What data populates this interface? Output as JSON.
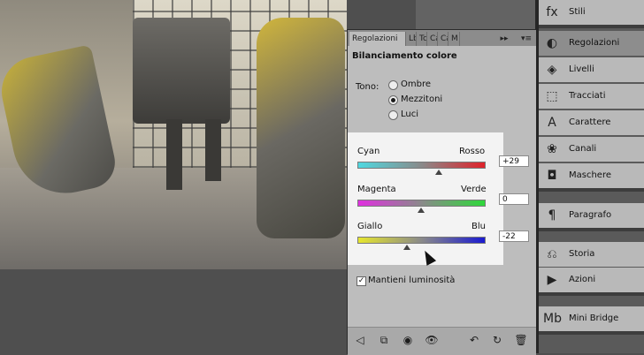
{
  "panel": {
    "tabs": [
      "Regolazioni",
      "Lb",
      "Tc",
      "Ca",
      "Ca",
      "M"
    ],
    "collapse_glyph": "▸▸",
    "menu_glyph": "▾≡",
    "title": "Bilanciamento colore",
    "tono_label": "Tono:",
    "tone_options": [
      {
        "label": "Ombre",
        "selected": false
      },
      {
        "label": "Mezzitoni",
        "selected": true
      },
      {
        "label": "Luci",
        "selected": false
      }
    ],
    "sliders": [
      {
        "left": "Cyan",
        "right": "Rosso",
        "value": "+29",
        "numeric": 29,
        "gradient": [
          "#4fd8e0",
          "#e0222a"
        ]
      },
      {
        "left": "Magenta",
        "right": "Verde",
        "value": "0",
        "numeric": 0,
        "gradient": [
          "#e02fe0",
          "#2ed83a"
        ]
      },
      {
        "left": "Giallo",
        "right": "Blu",
        "value": "-22",
        "numeric": -22,
        "gradient": [
          "#e6e62e",
          "#1a1ad0"
        ]
      }
    ],
    "preserve_luminosity": {
      "label": "Mantieni luminosità",
      "checked": true,
      "check_glyph": "✓"
    },
    "footer_icons": [
      {
        "name": "back-icon",
        "glyph": "◁"
      },
      {
        "name": "clip-layer-icon",
        "glyph": "⧉"
      },
      {
        "name": "mask-icon",
        "glyph": "◉"
      },
      {
        "name": "visibility-icon",
        "glyph": "👁"
      },
      {
        "name": "previous-state-icon",
        "glyph": "↶"
      },
      {
        "name": "reset-icon",
        "glyph": "↻"
      },
      {
        "name": "trash-icon",
        "glyph": "🗑"
      }
    ]
  },
  "dock": {
    "items": [
      {
        "label": "Stili",
        "icon": "fx-icon",
        "glyph": "fx",
        "active": false
      },
      {
        "label": "Regolazioni",
        "icon": "adjustments-icon",
        "glyph": "◐",
        "active": true
      },
      {
        "label": "Livelli",
        "icon": "layers-icon",
        "glyph": "◈",
        "active": false
      },
      {
        "label": "Tracciati",
        "icon": "paths-icon",
        "glyph": "⬚",
        "active": false
      },
      {
        "label": "Carattere",
        "icon": "character-icon",
        "glyph": "A",
        "active": false
      },
      {
        "label": "Canali",
        "icon": "channels-icon",
        "glyph": "❀",
        "active": false
      },
      {
        "label": "Maschere",
        "icon": "masks-icon",
        "glyph": "◘",
        "active": false
      },
      {
        "label": "Paragrafo",
        "icon": "paragraph-icon",
        "glyph": "¶",
        "active": false
      },
      {
        "label": "Storia",
        "icon": "history-icon",
        "glyph": "⎌",
        "active": false
      },
      {
        "label": "Azioni",
        "icon": "actions-icon",
        "glyph": "▶",
        "active": false
      },
      {
        "label": "Mini Bridge",
        "icon": "mini-bridge-icon",
        "glyph": "Mb",
        "active": false
      }
    ]
  }
}
